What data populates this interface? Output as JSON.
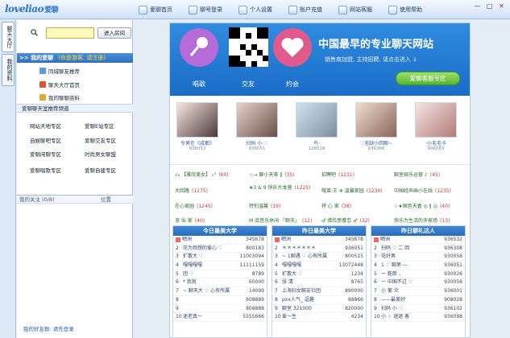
{
  "app": {
    "logo_text": "loveliao",
    "logo_cn": "爱聊",
    "nav": [
      "爱聊首页",
      "聊号登录",
      "个人设置",
      "账户充值",
      "网站客服",
      "使用帮助"
    ],
    "window_buttons": [
      "—",
      "□",
      "✕"
    ]
  },
  "vtabs": [
    "聊天大厅",
    "我的资料"
  ],
  "left": {
    "search_placeholder": "",
    "search_button": "进入房间",
    "my_love_header": ">>  我的爱聊",
    "my_love_note": "(你是游客, 请注册)",
    "my_love_items": [
      "同城聊友推荐",
      "聊天大厅首页",
      "我的聊聊资料"
    ],
    "channel_header": "爱聊聊天室推荐频道",
    "zones": [
      [
        "网站天地专区",
        "爱聊E站专区"
      ],
      [
        "自娱聊吧专区",
        "爱聊交友专区"
      ],
      [
        "爱聊闲聊专区",
        "时尚男女聊盟"
      ],
      [
        "爱聊唱歌专区",
        "爱聊自建专区"
      ]
    ],
    "attention_label": "我的关注 (0/8)",
    "position_label": "位置",
    "bottom_status": "我的好友群: 请先登录"
  },
  "banner": {
    "icons": [
      "唱歌",
      "交友",
      "约会"
    ],
    "title": "中国最早的专业聊天网站",
    "subtitle": "销售商加盟,  主持招聘,  请点击进入 ↓",
    "button": "爱聊客服专区"
  },
  "avatars": [
    {
      "name": "令男在《成都》",
      "id": "936012"
    },
    {
      "name": "扫码 小 ♡",
      "id": "936051"
    },
    {
      "name": "鸟·",
      "id": "128028"
    },
    {
      "name": "♡无缺小回聊~",
      "id": "936366"
    },
    {
      "name": "·小毛毛卡",
      "id": "906083"
    }
  ],
  "rooms": [
    [
      "√₆ 【雅欣美女】 ₀°",
      "(60)",
      "☆→ 聊小天茶 ‖",
      "(35)",
      "招聘吧",
      "(1231)",
      "聊室娱乐运营 ♪",
      "(45)"
    ],
    [
      "大回路",
      "(1275)",
      "★3 & 9 快乐大本营",
      "(1225)",
      "哦莱·王 ❄ 温馨家园",
      "(1230)",
      "中国经声画小在线",
      "(1235)"
    ],
    [
      "在心家园",
      "(1245)",
      "特别温馨",
      "(19)",
      "将 心 家",
      "(38)",
      "☆★国色天香 ◎ ‖ ◎",
      "(40)"
    ],
    [
      "浪 仙 家",
      "(40)",
      "M 品音乐休闲 『聊天』",
      "(12)",
      "♂ 缘恰思眷恋 ♂",
      "(32)",
      "快乐为生活的多家场",
      "(13)"
    ]
  ],
  "rankings": [
    {
      "title": "今日最美大学",
      "rows": [
        [
          "1",
          "晒洲",
          "345678"
        ],
        [
          "2",
          "花为烦想的爱心 ♡",
          "800183"
        ],
        [
          "3",
          "扩散大 ♡",
          "11003094"
        ],
        [
          "4",
          "嘎嘎嘎嘎",
          "11111159"
        ],
        [
          "5",
          "团 ♡",
          "8789"
        ],
        [
          "6",
          "* 我就",
          "60000"
        ],
        [
          "7",
          "~ 聊天大 ♡ 心有所属",
          "14099"
        ],
        [
          "8",
          "",
          "608889"
        ],
        [
          "9",
          "",
          "808888"
        ],
        [
          "10",
          "迷老真一",
          "5555666"
        ]
      ]
    },
    {
      "title": "昨日最美大学",
      "rows": [
        [
          "1",
          "晒洲",
          "345678"
        ],
        [
          "2",
          "＊＊＊＊＊＊＊",
          "936051"
        ],
        [
          "3",
          "~ 1聊遇 ♡ 心有所属",
          "800515"
        ],
        [
          "4",
          "嘎嘎嘎嘎",
          "13072448"
        ],
        [
          "5",
          "扩散大 ♡",
          "1234"
        ],
        [
          "6",
          "张  清",
          "8765"
        ],
        [
          "7",
          "上海妇女聊友社团",
          "890000"
        ],
        [
          "8",
          "pxx人气_ 逗趣",
          "88866"
        ],
        [
          "9",
          "聊室 321000",
          "820000"
        ],
        [
          "10",
          "爱一生",
          "4234"
        ]
      ]
    },
    {
      "title": "昨日聊礼达人",
      "rows": [
        [
          "1",
          "晒洲",
          "936532"
        ],
        [
          "2",
          "扫码 ♡ 二 回",
          "936308"
        ],
        [
          "3",
          "花好男",
          "930058"
        ],
        [
          "4",
          "1 ♡ 聊男·—",
          "936051"
        ],
        [
          "5",
          "一 乾郎 、",
          "930026"
        ],
        [
          "6",
          "一 中国不过 ♡",
          "930058"
        ],
        [
          "7",
          "小 葡 众",
          "936001"
        ],
        [
          "8",
          "——最美好",
          "908028"
        ],
        [
          "9",
          "扫码 小 ♡",
          "936102"
        ],
        [
          "10",
          "小 ☆ 迷迷 客",
          "936098"
        ]
      ]
    }
  ]
}
